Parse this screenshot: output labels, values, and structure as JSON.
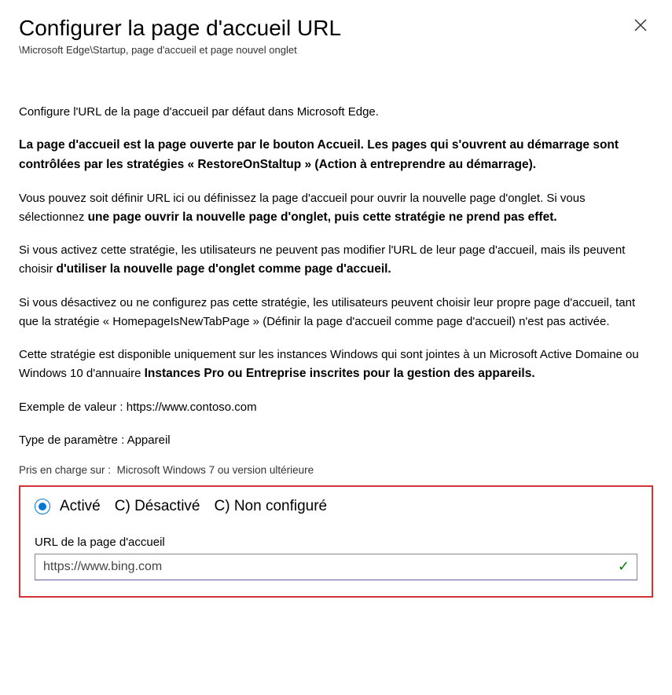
{
  "header": {
    "title": "Configurer la page d'accueil   URL",
    "breadcrumb": "\\Microsoft Edge\\Startup, page d'accueil et page nouvel onglet"
  },
  "body": {
    "p1": "Configure l'URL de la page d'accueil par défaut dans      Microsoft Edge.",
    "p2": "La page d'accueil est la page ouverte par le bouton Accueil. Les pages qui s'ouvrent au démarrage sont contrôlées par les stratégies « RestoreOnStaltup » (Action à entreprendre au démarrage).",
    "p3a": "Vous pouvez soit définir     URL ici ou définissez la page d'accueil pour ouvrir la nouvelle page d'onglet.        Si vous sélectionnez ",
    "p3b": "une page ouvrir la nouvelle page d'onglet, puis cette stratégie ne prend pas effet.",
    "p4a": "Si vous activez cette stratégie, les utilisateurs ne peuvent pas modifier l'URL de leur page d'accueil, mais ils peuvent choisir ",
    "p4b": "d'utiliser la nouvelle page d'onglet comme page d'accueil.",
    "p5": "Si vous désactivez ou ne configurez pas cette stratégie, les utilisateurs peuvent choisir leur propre page d'accueil, tant que la stratégie « HomepageIsNewTabPage » (Définir la page d'accueil comme page d'accueil) n'est pas activée.",
    "p6a": "Cette stratégie est disponible uniquement sur les instances Windows qui sont jointes à un Microsoft Active Domaine ou Windows 10 d'annuaire    ",
    "p6b": "Instances Pro ou Entreprise inscrites pour la gestion des appareils.",
    "example": "Exemple de valeur : https://www.contoso.com",
    "settingType": "Type de paramètre : Appareil",
    "supported_label": "Pris en charge sur :",
    "supported_value": "Microsoft Windows 7 ou version ultérieure"
  },
  "config": {
    "radios": {
      "enabled": "Activé",
      "disabled": "C) Désactivé",
      "notConfigured": "C) Non configuré"
    },
    "input_label": "URL de la page d'accueil",
    "input_value": "https://www.bing.com"
  }
}
